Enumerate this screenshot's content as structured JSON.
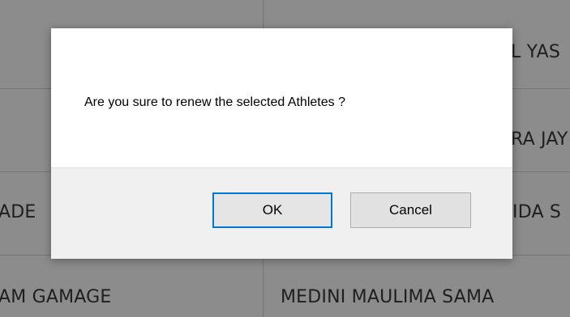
{
  "background_table": {
    "rows": [
      {
        "left": "",
        "right": "L YAS"
      },
      {
        "left": "",
        "right": "RA JAY"
      },
      {
        "left": "ADE",
        "right": "IDA S"
      },
      {
        "left": "AM GAMAGE",
        "right": "MEDINI MAULIMA SAMA"
      }
    ]
  },
  "dialog": {
    "message": "Are you sure to renew the selected Athletes ?",
    "ok_label": "OK",
    "cancel_label": "Cancel"
  }
}
